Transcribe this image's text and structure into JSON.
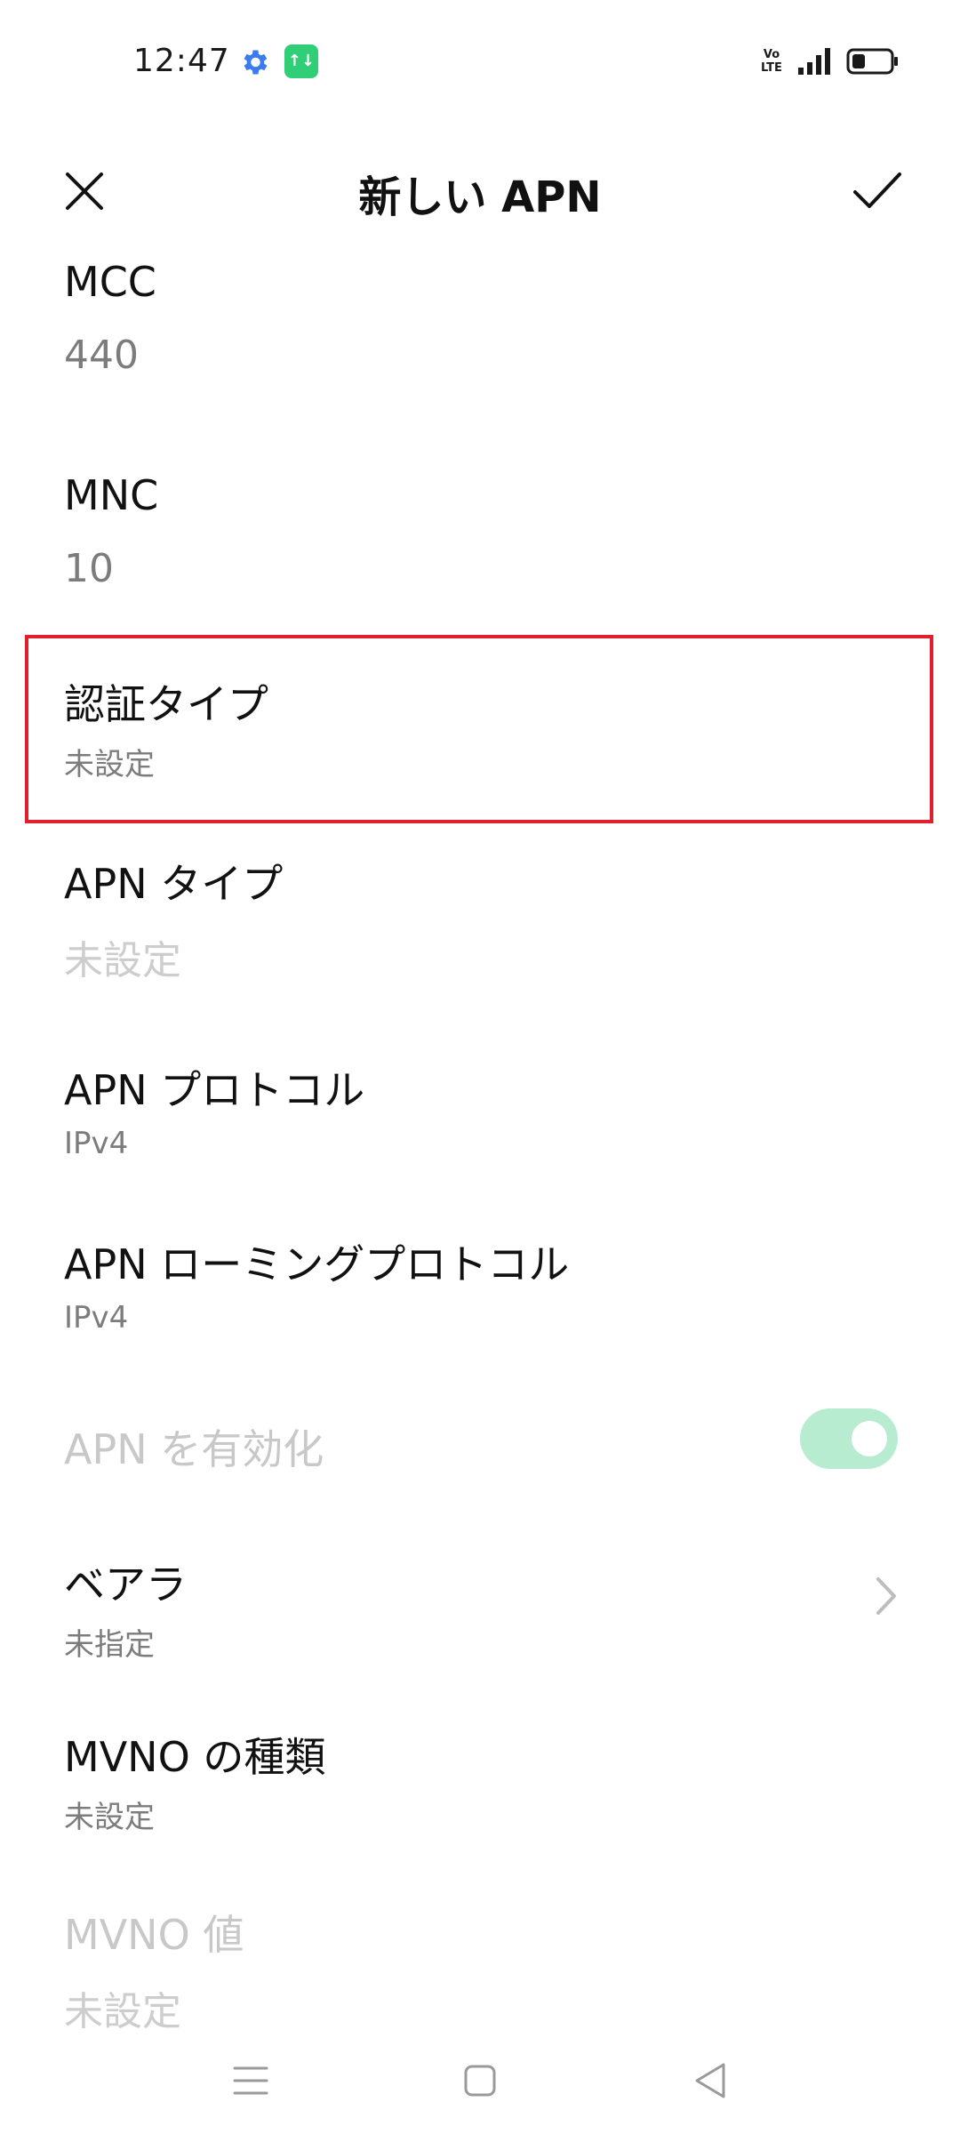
{
  "status_bar": {
    "time": "12:47",
    "icons": [
      "gear-icon",
      "data-transfer-icon",
      "volte-icon",
      "signal-icon",
      "battery-icon"
    ],
    "data_icon_text": "↑↓",
    "volte_text": "Vo\nLTE",
    "battery_level": 0.35
  },
  "header": {
    "title": "新しい APN",
    "close_icon": "close-icon",
    "confirm_icon": "checkmark-icon"
  },
  "settings": {
    "mcc": {
      "label": "MCC",
      "value": "440"
    },
    "mnc": {
      "label": "MNC",
      "value": "10"
    },
    "auth_type": {
      "label": "認証タイプ",
      "value": "未設定",
      "highlighted": true
    },
    "apn_type": {
      "label": "APN タイプ",
      "value": "未設定"
    },
    "apn_protocol": {
      "label": "APN プロトコル",
      "value": "IPv4"
    },
    "apn_roaming_protocol": {
      "label": "APN ローミングプロトコル",
      "value": "IPv4"
    },
    "apn_enable": {
      "label": "APN を有効化",
      "enabled": true,
      "disabled_state": true
    },
    "bearer": {
      "label": "ベアラ",
      "value": "未指定"
    },
    "mvno_type": {
      "label": "MVNO の種類",
      "value": "未設定"
    },
    "mvno_value": {
      "label": "MVNO 値",
      "value": "未設定"
    }
  },
  "colors": {
    "highlight_border": "#e0202e",
    "toggle_track": "#b7ecd0",
    "data_badge": "#2fce77",
    "gear_icon": "#3b7bf0"
  },
  "nav_bar": {
    "buttons": [
      "menu-icon",
      "home-icon",
      "back-icon"
    ]
  }
}
